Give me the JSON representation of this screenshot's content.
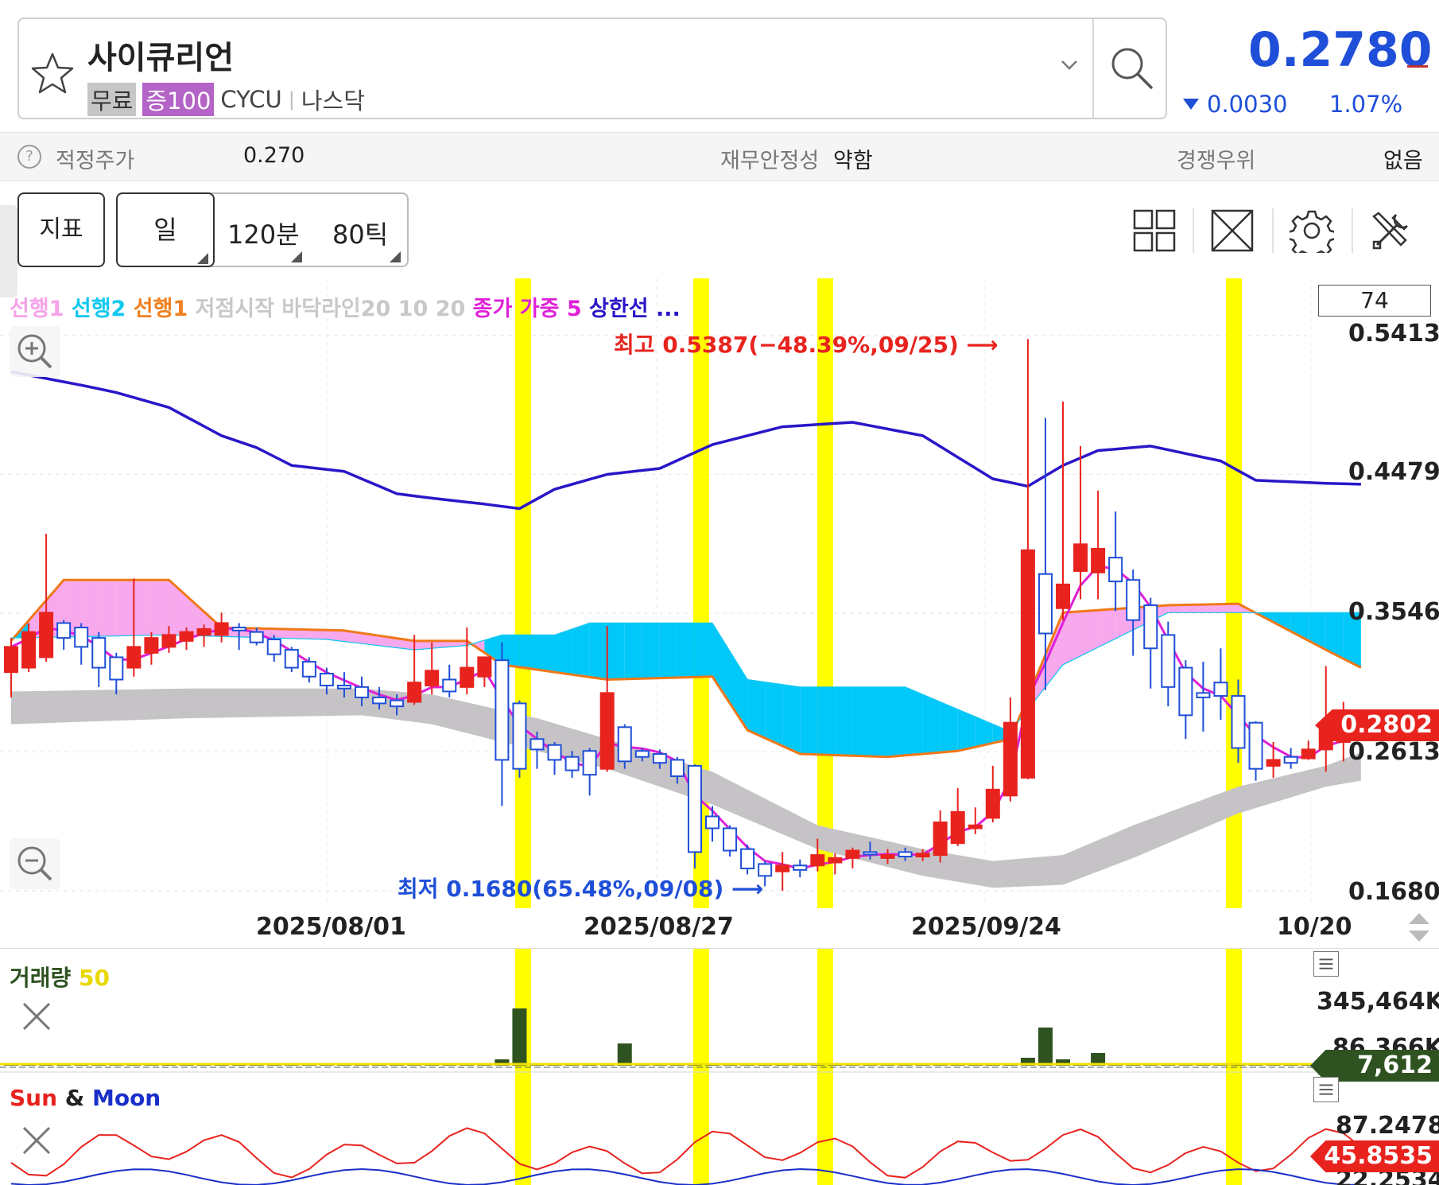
{
  "header": {
    "stock_name": "사이큐리언",
    "tags": {
      "free": "무료",
      "margin": "증100",
      "ticker": "CYCU",
      "market": "나스닥"
    },
    "price": "0.2780",
    "change_value": "0.0030",
    "change_pct": "1.07%",
    "change_direction": "down",
    "up_color": "#e8231e",
    "down_color": "#1f4fd8"
  },
  "info_strip": {
    "fair_price_label": "적정주가",
    "fair_price_value": "0.270",
    "stability_label": "재무안정성",
    "stability_value": "약함",
    "advantage_label": "경쟁우위",
    "advantage_value": "없음"
  },
  "toolbar": {
    "indicator_tab": "지표",
    "period_day": "일",
    "period_120min": "120분",
    "period_80tick": "80틱",
    "icons": [
      "grid-layout-icon",
      "fullscreen-icon",
      "settings-gear-icon",
      "tools-icon"
    ]
  },
  "legend": [
    {
      "label": "선행1",
      "color": "#f5a3e8"
    },
    {
      "label": "선행2",
      "color": "#10c8f0"
    },
    {
      "label": "선행1",
      "color": "#f08020"
    },
    {
      "label": "저점시작 바닥라인20 10 20",
      "color": "#c8c8c8"
    },
    {
      "label": "종가 가중 5",
      "color": "#e020d8"
    },
    {
      "label": "상한선 ...",
      "color": "#2a16c8"
    }
  ],
  "chart_box_label": "74",
  "chart_data": [
    {
      "type": "candlestick",
      "title": "",
      "ylim": [
        0.168,
        0.5413
      ],
      "y_ticks": [
        "0.5413",
        "0.4479",
        "0.3546",
        "0.2613",
        "0.1680"
      ],
      "x_ticks": [
        "2025/08/01",
        "2025/08/27",
        "2025/09/24",
        "10/20"
      ],
      "last_price_tag": "0.2802",
      "annotations": {
        "high": "최고 0.5387(−48.39%,09/25)",
        "low": "최저 0.1680(65.48%,09/08)"
      },
      "candles": [
        {
          "o": 0.315,
          "h": 0.338,
          "l": 0.298,
          "c": 0.332
        },
        {
          "o": 0.318,
          "h": 0.348,
          "l": 0.315,
          "c": 0.342
        },
        {
          "o": 0.325,
          "h": 0.408,
          "l": 0.322,
          "c": 0.355
        },
        {
          "o": 0.348,
          "h": 0.35,
          "l": 0.33,
          "c": 0.338
        },
        {
          "o": 0.345,
          "h": 0.348,
          "l": 0.32,
          "c": 0.332
        },
        {
          "o": 0.338,
          "h": 0.342,
          "l": 0.305,
          "c": 0.318
        },
        {
          "o": 0.325,
          "h": 0.328,
          "l": 0.3,
          "c": 0.31
        },
        {
          "o": 0.318,
          "h": 0.378,
          "l": 0.312,
          "c": 0.332
        },
        {
          "o": 0.328,
          "h": 0.342,
          "l": 0.32,
          "c": 0.338
        },
        {
          "o": 0.332,
          "h": 0.346,
          "l": 0.328,
          "c": 0.34
        },
        {
          "o": 0.336,
          "h": 0.345,
          "l": 0.33,
          "c": 0.342
        },
        {
          "o": 0.34,
          "h": 0.347,
          "l": 0.332,
          "c": 0.344
        },
        {
          "o": 0.34,
          "h": 0.355,
          "l": 0.335,
          "c": 0.348
        },
        {
          "o": 0.345,
          "h": 0.348,
          "l": 0.33,
          "c": 0.343
        },
        {
          "o": 0.342,
          "h": 0.345,
          "l": 0.333,
          "c": 0.335
        },
        {
          "o": 0.337,
          "h": 0.34,
          "l": 0.322,
          "c": 0.327
        },
        {
          "o": 0.33,
          "h": 0.332,
          "l": 0.315,
          "c": 0.318
        },
        {
          "o": 0.322,
          "h": 0.325,
          "l": 0.308,
          "c": 0.312
        },
        {
          "o": 0.314,
          "h": 0.318,
          "l": 0.3,
          "c": 0.306
        },
        {
          "o": 0.306,
          "h": 0.315,
          "l": 0.298,
          "c": 0.304
        },
        {
          "o": 0.305,
          "h": 0.312,
          "l": 0.292,
          "c": 0.298
        },
        {
          "o": 0.298,
          "h": 0.305,
          "l": 0.29,
          "c": 0.294
        },
        {
          "o": 0.296,
          "h": 0.3,
          "l": 0.286,
          "c": 0.292
        },
        {
          "o": 0.295,
          "h": 0.34,
          "l": 0.293,
          "c": 0.308
        },
        {
          "o": 0.306,
          "h": 0.335,
          "l": 0.3,
          "c": 0.316
        },
        {
          "o": 0.31,
          "h": 0.32,
          "l": 0.298,
          "c": 0.302
        },
        {
          "o": 0.305,
          "h": 0.345,
          "l": 0.3,
          "c": 0.318
        },
        {
          "o": 0.312,
          "h": 0.325,
          "l": 0.305,
          "c": 0.325
        },
        {
          "o": 0.323,
          "h": 0.335,
          "l": 0.225,
          "c": 0.256
        },
        {
          "o": 0.294,
          "h": 0.296,
          "l": 0.244,
          "c": 0.25
        },
        {
          "o": 0.27,
          "h": 0.275,
          "l": 0.25,
          "c": 0.263
        },
        {
          "o": 0.266,
          "h": 0.268,
          "l": 0.246,
          "c": 0.256
        },
        {
          "o": 0.258,
          "h": 0.262,
          "l": 0.244,
          "c": 0.249
        },
        {
          "o": 0.262,
          "h": 0.264,
          "l": 0.232,
          "c": 0.246
        },
        {
          "o": 0.25,
          "h": 0.346,
          "l": 0.248,
          "c": 0.301
        },
        {
          "o": 0.278,
          "h": 0.28,
          "l": 0.25,
          "c": 0.255
        },
        {
          "o": 0.262,
          "h": 0.264,
          "l": 0.255,
          "c": 0.258
        },
        {
          "o": 0.26,
          "h": 0.263,
          "l": 0.25,
          "c": 0.254
        },
        {
          "o": 0.256,
          "h": 0.258,
          "l": 0.24,
          "c": 0.245
        },
        {
          "o": 0.252,
          "h": 0.253,
          "l": 0.183,
          "c": 0.194
        },
        {
          "o": 0.218,
          "h": 0.225,
          "l": 0.201,
          "c": 0.21
        },
        {
          "o": 0.21,
          "h": 0.212,
          "l": 0.191,
          "c": 0.195
        },
        {
          "o": 0.196,
          "h": 0.199,
          "l": 0.179,
          "c": 0.183
        },
        {
          "o": 0.186,
          "h": 0.188,
          "l": 0.171,
          "c": 0.178
        },
        {
          "o": 0.181,
          "h": 0.194,
          "l": 0.168,
          "c": 0.185
        },
        {
          "o": 0.185,
          "h": 0.189,
          "l": 0.177,
          "c": 0.182
        },
        {
          "o": 0.185,
          "h": 0.203,
          "l": 0.181,
          "c": 0.192
        },
        {
          "o": 0.187,
          "h": 0.193,
          "l": 0.179,
          "c": 0.19
        },
        {
          "o": 0.19,
          "h": 0.197,
          "l": 0.183,
          "c": 0.195
        },
        {
          "o": 0.194,
          "h": 0.201,
          "l": 0.189,
          "c": 0.193
        },
        {
          "o": 0.19,
          "h": 0.196,
          "l": 0.186,
          "c": 0.192
        },
        {
          "o": 0.194,
          "h": 0.197,
          "l": 0.188,
          "c": 0.191
        },
        {
          "o": 0.191,
          "h": 0.196,
          "l": 0.188,
          "c": 0.193
        },
        {
          "o": 0.192,
          "h": 0.222,
          "l": 0.187,
          "c": 0.214
        },
        {
          "o": 0.2,
          "h": 0.237,
          "l": 0.198,
          "c": 0.221
        },
        {
          "o": 0.21,
          "h": 0.224,
          "l": 0.206,
          "c": 0.212
        },
        {
          "o": 0.217,
          "h": 0.252,
          "l": 0.214,
          "c": 0.236
        },
        {
          "o": 0.232,
          "h": 0.298,
          "l": 0.228,
          "c": 0.281
        },
        {
          "o": 0.244,
          "h": 0.539,
          "l": 0.243,
          "c": 0.397
        },
        {
          "o": 0.381,
          "h": 0.486,
          "l": 0.303,
          "c": 0.341
        },
        {
          "o": 0.358,
          "h": 0.497,
          "l": 0.35,
          "c": 0.374
        },
        {
          "o": 0.383,
          "h": 0.467,
          "l": 0.364,
          "c": 0.401
        },
        {
          "o": 0.382,
          "h": 0.437,
          "l": 0.364,
          "c": 0.398
        },
        {
          "o": 0.392,
          "h": 0.423,
          "l": 0.356,
          "c": 0.376
        },
        {
          "o": 0.377,
          "h": 0.384,
          "l": 0.326,
          "c": 0.35
        },
        {
          "o": 0.36,
          "h": 0.365,
          "l": 0.304,
          "c": 0.331
        },
        {
          "o": 0.34,
          "h": 0.349,
          "l": 0.292,
          "c": 0.305
        },
        {
          "o": 0.318,
          "h": 0.323,
          "l": 0.27,
          "c": 0.286
        },
        {
          "o": 0.301,
          "h": 0.322,
          "l": 0.275,
          "c": 0.298
        },
        {
          "o": 0.308,
          "h": 0.331,
          "l": 0.283,
          "c": 0.299
        },
        {
          "o": 0.299,
          "h": 0.31,
          "l": 0.254,
          "c": 0.264
        },
        {
          "o": 0.281,
          "h": 0.282,
          "l": 0.242,
          "c": 0.25
        },
        {
          "o": 0.252,
          "h": 0.268,
          "l": 0.244,
          "c": 0.256
        },
        {
          "o": 0.258,
          "h": 0.264,
          "l": 0.25,
          "c": 0.254
        },
        {
          "o": 0.257,
          "h": 0.269,
          "l": 0.256,
          "c": 0.263
        },
        {
          "o": 0.263,
          "h": 0.319,
          "l": 0.248,
          "c": 0.281
        },
        {
          "o": 0.268,
          "h": 0.295,
          "l": 0.255,
          "c": 0.271
        },
        {
          "o": 0.278,
          "h": 0.282,
          "l": 0.276,
          "c": 0.2802
        }
      ]
    },
    {
      "type": "bar",
      "title": "거래량",
      "ma_label": "50",
      "y_ticks": [
        "345,464K",
        "86,366K"
      ],
      "last_value_tag": "7,612"
    },
    {
      "type": "line",
      "title": "Sun & Moon",
      "title_parts": [
        "Sun",
        "&",
        "Moon"
      ],
      "y_ticks": [
        "87.2478",
        "22.2534"
      ],
      "last_value_tag": "45.8535"
    }
  ]
}
